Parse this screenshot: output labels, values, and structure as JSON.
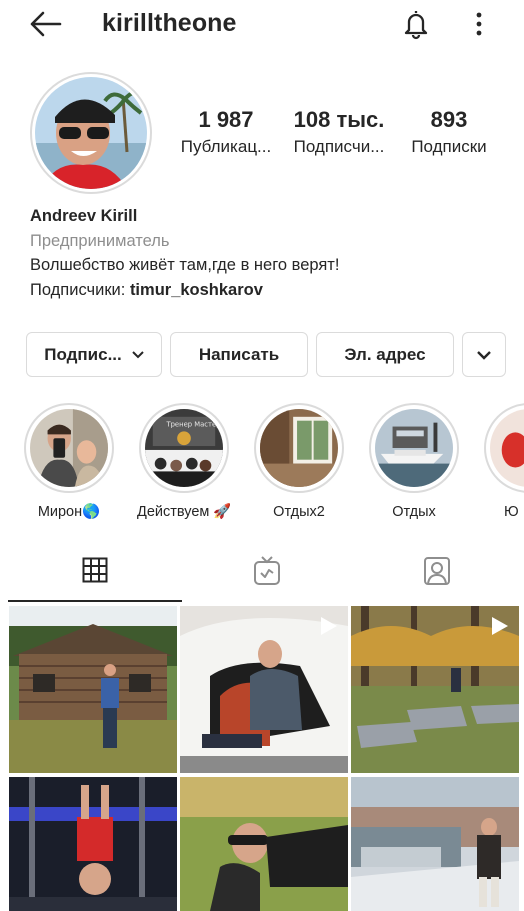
{
  "header": {
    "username": "kirilltheone",
    "icons": {
      "back": "arrow-left-icon",
      "notifications": "bell-icon",
      "more": "more-vertical-icon"
    }
  },
  "profile": {
    "stats": [
      {
        "value": "1 987",
        "label": "Публикац..."
      },
      {
        "value": "108 тыс.",
        "label": "Подписчи..."
      },
      {
        "value": "893",
        "label": "Подписки"
      }
    ],
    "name": "Andreev Kirill",
    "category": "Предприниматель",
    "bio_line": "Волшебство живёт там,где в него верят!",
    "subscribers_prefix": "Подписчики: ",
    "subscribers_mention": "timur_koshkarov"
  },
  "buttons": {
    "follow": "Подпис...",
    "message": "Написать",
    "email": "Эл. адрес"
  },
  "highlights": [
    {
      "label": "Мирон🌎"
    },
    {
      "label": "Действуем 🚀"
    },
    {
      "label": "Отдых2"
    },
    {
      "label": "Отдых"
    },
    {
      "label": "Ю"
    }
  ],
  "tabs": [
    {
      "icon": "grid-icon",
      "active": true
    },
    {
      "icon": "igtv-icon",
      "active": false
    },
    {
      "icon": "tagged-person-icon",
      "active": false
    }
  ],
  "colors": {
    "text": "#262626",
    "secondary": "#8e8e8e",
    "border": "#dbdbdb"
  }
}
